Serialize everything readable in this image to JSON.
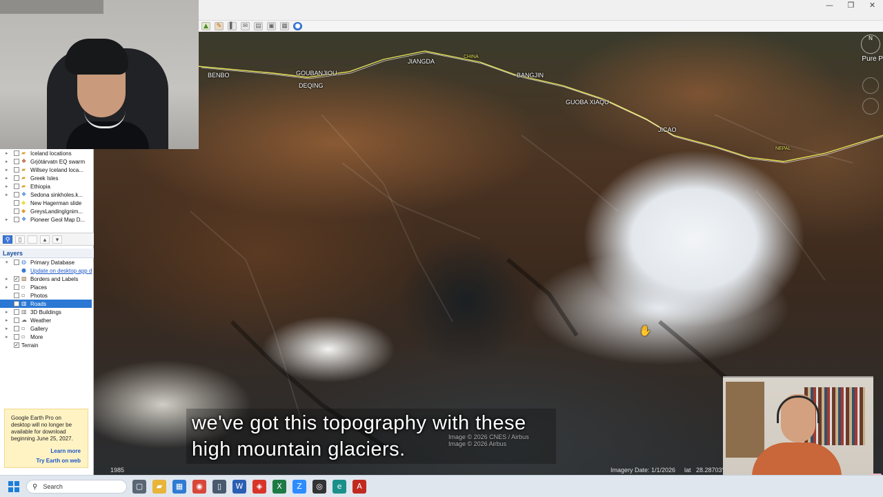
{
  "window": {
    "controls": {
      "minimize": "—",
      "restore": "❐",
      "close": "✕"
    }
  },
  "toolbar": {
    "buttons": [
      {
        "icon": "image-overlay-icon",
        "glyph": "▲"
      },
      {
        "icon": "path-icon",
        "glyph": "✎"
      },
      {
        "icon": "tour-icon",
        "glyph": "▌"
      },
      {
        "icon": "email-icon",
        "glyph": "✉"
      },
      {
        "icon": "print-icon",
        "glyph": "▤"
      },
      {
        "icon": "save-image-icon",
        "glyph": "▣"
      },
      {
        "icon": "view-in-maps-icon",
        "glyph": "▦"
      },
      {
        "icon": "earth-icon",
        "glyph": "●"
      }
    ]
  },
  "map": {
    "place_labels": [
      {
        "text": "BENBO"
      },
      {
        "text": "GOUBANJIOU"
      },
      {
        "text": "DEQING"
      },
      {
        "text": "JIANGDA"
      },
      {
        "text": "CHINA"
      },
      {
        "text": "BANGJIN"
      },
      {
        "text": "GUOBA XIAQU"
      },
      {
        "text": "JICAO"
      },
      {
        "text": "NEPAL"
      }
    ],
    "compass_label": "N",
    "pure_label": "Pure P",
    "attribution": [
      "Image © 2026 CNES / Airbus",
      "Image © 2026 Airbus"
    ],
    "status": {
      "year": "1985",
      "imagery_date": "Imagery Date: 1/1/2026",
      "lat_label": "lat",
      "lat_value": "28.28703°"
    },
    "cursor_glyph": "✋"
  },
  "caption": {
    "line1": "we've got this topography with these",
    "line2": "high mountain glaciers."
  },
  "places": {
    "items": [
      {
        "label": "Iceland locations",
        "icon": "folder-icon",
        "checked": false
      },
      {
        "label": "Grjótárvatn EQ swarm",
        "icon": "kml-icon",
        "checked": false
      },
      {
        "label": "Willsey Iceland loca...",
        "icon": "folder-icon",
        "checked": false
      },
      {
        "label": "Greek Isles",
        "icon": "folder-icon",
        "checked": false
      },
      {
        "label": "Ethiopia",
        "icon": "folder-icon",
        "checked": false
      },
      {
        "label": "Sedona sinkholes.k...",
        "icon": "kml-icon",
        "checked": false
      },
      {
        "label": "New Hagerman slide",
        "icon": "polygon-icon",
        "checked": false
      },
      {
        "label": "GreysLandingIgnim...",
        "icon": "polygon-icon",
        "checked": false
      },
      {
        "label": "Pioneer Geol Map D...",
        "icon": "kml-icon",
        "checked": false
      }
    ]
  },
  "layers": {
    "title": "Layers",
    "items": [
      {
        "label": "Primary Database",
        "icon": "globe-icon",
        "checked": false,
        "expander": "▾",
        "selected": false
      },
      {
        "label": "Update on desktop app d",
        "icon": "info-icon",
        "checked": false,
        "expander": "",
        "selected": false,
        "link": true
      },
      {
        "label": "Borders and Labels",
        "icon": "borders-icon",
        "checked": true,
        "expander": "▸",
        "selected": false
      },
      {
        "label": "Places",
        "icon": "places-icon",
        "checked": false,
        "expander": "▸",
        "selected": false
      },
      {
        "label": "Photos",
        "icon": "photos-icon",
        "checked": false,
        "expander": "",
        "selected": false
      },
      {
        "label": "Roads",
        "icon": "roads-icon",
        "checked": false,
        "expander": "",
        "selected": true
      },
      {
        "label": "3D Buildings",
        "icon": "buildings-icon",
        "checked": false,
        "expander": "▸",
        "selected": false
      },
      {
        "label": "Weather",
        "icon": "weather-icon",
        "checked": false,
        "expander": "▸",
        "selected": false
      },
      {
        "label": "Gallery",
        "icon": "gallery-icon",
        "checked": false,
        "expander": "▸",
        "selected": false
      },
      {
        "label": "More",
        "icon": "more-icon",
        "checked": false,
        "expander": "▸",
        "selected": false
      },
      {
        "label": "Terrain",
        "icon": "",
        "checked": true,
        "expander": "",
        "selected": false
      }
    ]
  },
  "notice": {
    "text": "Google Earth Pro on desktop will no longer be available for download beginning June 25, 2027.",
    "learn_more": "Learn more",
    "try_web": "Try Earth on web"
  },
  "taskbar": {
    "search_placeholder": "Search",
    "apps": [
      {
        "icon": "task-view-icon",
        "glyph": "▢",
        "color": "#5b6675"
      },
      {
        "icon": "file-explorer-icon",
        "glyph": "▰",
        "color": "#e8b43a"
      },
      {
        "icon": "store-icon",
        "glyph": "▦",
        "color": "#2f7bd3"
      },
      {
        "icon": "chrome-icon",
        "glyph": "◉",
        "color": "#d9463a"
      },
      {
        "icon": "document-icon",
        "glyph": "▯",
        "color": "#4a5a6e"
      },
      {
        "icon": "word-icon",
        "glyph": "W",
        "color": "#2b5fb4"
      },
      {
        "icon": "adobe-icon",
        "glyph": "◈",
        "color": "#d8352a"
      },
      {
        "icon": "excel-icon",
        "glyph": "X",
        "color": "#1e7a45"
      },
      {
        "icon": "zoom-icon",
        "glyph": "Z",
        "color": "#2d8cff"
      },
      {
        "icon": "github-icon",
        "glyph": "◎",
        "color": "#333"
      },
      {
        "icon": "edge-icon",
        "glyph": "e",
        "color": "#1b8f8a"
      },
      {
        "icon": "acrobat-icon",
        "glyph": "A",
        "color": "#c22a1f"
      }
    ]
  }
}
